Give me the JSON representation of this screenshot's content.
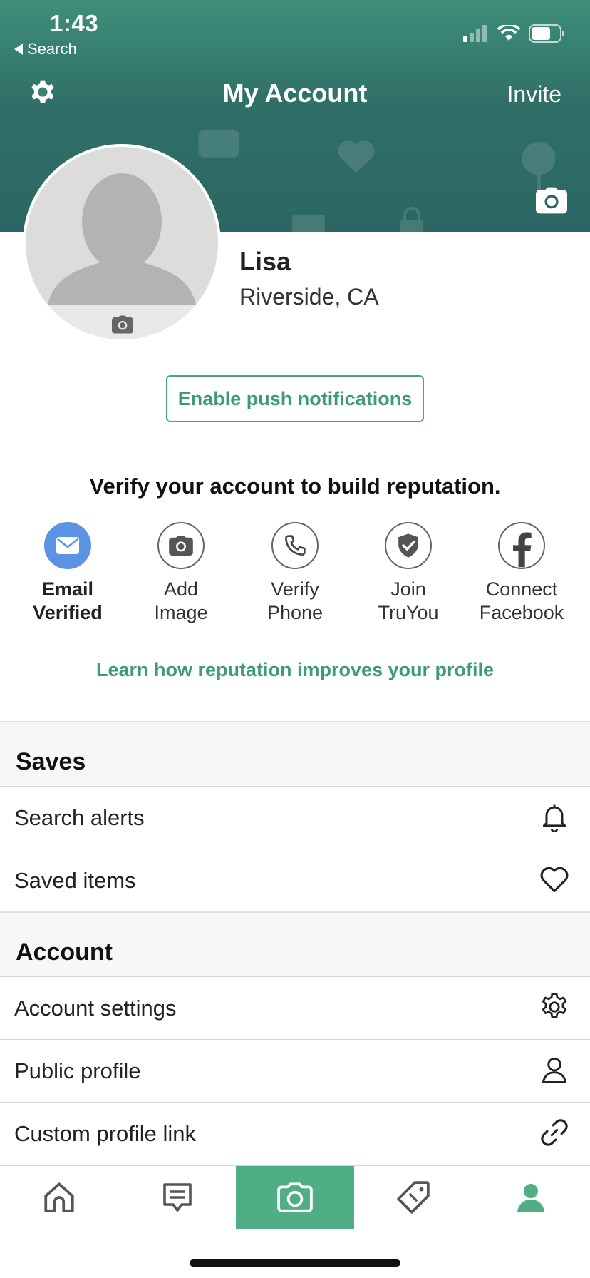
{
  "status_bar": {
    "time": "1:43",
    "back_label": "Search"
  },
  "navbar": {
    "title": "My Account",
    "invite_label": "Invite"
  },
  "profile": {
    "name": "Lisa",
    "location": "Riverside, CA"
  },
  "push_button_label": "Enable push notifications",
  "verify": {
    "title": "Verify your account to build reputation.",
    "items": [
      {
        "line1": "Email",
        "line2": "Verified",
        "icon": "envelope-icon",
        "done": true
      },
      {
        "line1": "Add",
        "line2": "Image",
        "icon": "camera-icon",
        "done": false
      },
      {
        "line1": "Verify",
        "line2": "Phone",
        "icon": "phone-icon",
        "done": false
      },
      {
        "line1": "Join",
        "line2": "TruYou",
        "icon": "shield-check-icon",
        "done": false
      },
      {
        "line1": "Connect",
        "line2": "Facebook",
        "icon": "facebook-icon",
        "done": false
      }
    ],
    "learn_link": "Learn how reputation improves your profile"
  },
  "saves": {
    "title": "Saves",
    "items": [
      {
        "label": "Search alerts",
        "icon": "bell-icon"
      },
      {
        "label": "Saved items",
        "icon": "heart-icon"
      }
    ]
  },
  "account": {
    "title": "Account",
    "items": [
      {
        "label": "Account settings",
        "icon": "gear-icon"
      },
      {
        "label": "Public profile",
        "icon": "person-icon"
      },
      {
        "label": "Custom profile link",
        "icon": "link-icon"
      }
    ]
  },
  "tabbar": {
    "tabs": [
      {
        "icon": "home-icon"
      },
      {
        "icon": "chat-icon"
      },
      {
        "icon": "camera-icon",
        "active": true
      },
      {
        "icon": "price-tag-icon"
      },
      {
        "icon": "profile-icon"
      }
    ]
  },
  "colors": {
    "header_green": "#2f6f68",
    "accent_green": "#3e9a78",
    "tab_active": "#4fae84",
    "verified_blue": "#5b93e3"
  }
}
